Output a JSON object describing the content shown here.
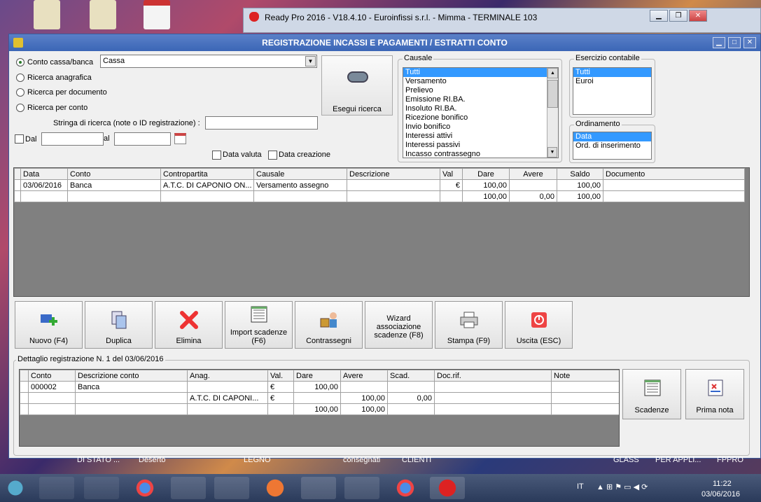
{
  "outer_window": {
    "title": "Ready Pro 2016 - V18.4.10 - Euroinfissi s.r.l. - Mimma - TERMINALE 103"
  },
  "main_window": {
    "title": "REGISTRAZIONE INCASSI E PAGAMENTI / ESTRATTI CONTO"
  },
  "search": {
    "options": [
      "Conto cassa/banca",
      "Ricerca anagrafica",
      "Ricerca per documento",
      "Ricerca per conto"
    ],
    "selected_option": "Conto cassa/banca",
    "account_value": "Cassa",
    "stringa_label": "Stringa di ricerca (note o ID registrazione) :",
    "stringa_value": "",
    "dal_label": "Dal",
    "al_label": "al",
    "data_valuta_label": "Data valuta",
    "data_creazione_label": "Data creazione",
    "search_button_label": "Esegui ricerca"
  },
  "causale": {
    "label": "Causale",
    "items": [
      "Tutti",
      "Versamento",
      "Prelievo",
      "Emissione RI.BA.",
      "Insoluto RI.BA.",
      "Ricezione bonifico",
      "Invio bonifico",
      "Interessi attivi",
      "Interessi passivi",
      "Incasso contrassegno"
    ],
    "selected": "Tutti"
  },
  "esercizio": {
    "label": "Esercizio contabile",
    "items": [
      "Tutti",
      "Euroi"
    ],
    "selected": "Tutti"
  },
  "ordinamento": {
    "label": "Ordinamento",
    "items": [
      "Data",
      "Ord. di inserimento"
    ],
    "selected": "Data"
  },
  "main_grid": {
    "columns": [
      "Data",
      "Conto",
      "Contropartita",
      "Causale",
      "Descrizione",
      "Val",
      "Dare",
      "Avere",
      "Saldo",
      "Documento"
    ],
    "rows": [
      [
        "03/06/2016",
        "Banca",
        "A.T.C. DI CAPONIO ON...",
        "Versamento assegno",
        "",
        "€",
        "100,00",
        "",
        "100,00",
        ""
      ],
      [
        "",
        "",
        "",
        "",
        "",
        "",
        "100,00",
        "0,00",
        "100,00",
        ""
      ]
    ]
  },
  "actions": [
    {
      "label": "Nuovo (F4)",
      "icon": "add-icon"
    },
    {
      "label": "Duplica",
      "icon": "duplicate-icon"
    },
    {
      "label": "Elimina",
      "icon": "delete-icon"
    },
    {
      "label": "Import scadenze (F6)",
      "icon": "import-icon"
    },
    {
      "label": "Contrassegni",
      "icon": "contrassegni-icon"
    },
    {
      "label": "Wizard associazione scadenze (F8)",
      "icon": ""
    },
    {
      "label": "Stampa (F9)",
      "icon": "printer-icon"
    },
    {
      "label": "Uscita (ESC)",
      "icon": "exit-icon"
    }
  ],
  "detail": {
    "title": "Dettaglio registrazione N. 1 del 03/06/2016",
    "columns": [
      "Conto",
      "Descrizione conto",
      "Anag.",
      "Val.",
      "Dare",
      "Avere",
      "Scad.",
      "Doc.rif.",
      "Note"
    ],
    "rows": [
      [
        "000002",
        "Banca",
        "",
        "€",
        "100,00",
        "",
        "",
        "",
        ""
      ],
      [
        "",
        "",
        "A.T.C. DI CAPONI...",
        "€",
        "",
        "100,00",
        "0,00",
        "",
        ""
      ],
      [
        "",
        "",
        "",
        "",
        "100,00",
        "100,00",
        "",
        "",
        ""
      ]
    ],
    "scadenze_label": "Scadenze",
    "prima_nota_label": "Prima nota"
  },
  "taskbar": {
    "lang": "IT",
    "time": "11:22",
    "date": "03/06/2016"
  },
  "wallpaper_labels": [
    "DI STATO ...",
    "Deserto",
    "LEGNO",
    "consegnati",
    "CLIENTI",
    "GLASS",
    "PER APPLI...",
    "FPPRO"
  ],
  "colors": {
    "title_bar": "#3b66b6",
    "selection": "#3399ff"
  }
}
